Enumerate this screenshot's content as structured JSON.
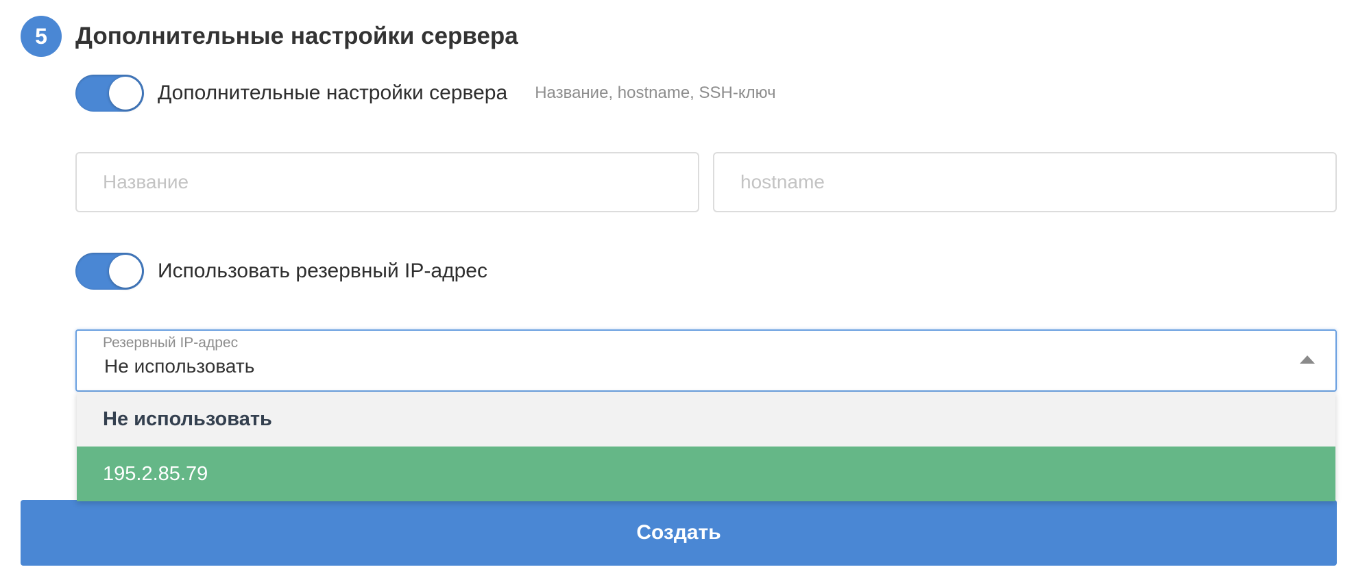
{
  "section": {
    "step_number": "5",
    "title": "Дополнительные настройки сервера"
  },
  "extra_settings_toggle": {
    "label": "Дополнительные настройки сервера",
    "hint": "Название, hostname, SSH-ключ",
    "enabled": true
  },
  "fields": {
    "name_placeholder": "Название",
    "name_value": "",
    "hostname_placeholder": "hostname",
    "hostname_value": ""
  },
  "reserve_ip_toggle": {
    "label": "Использовать резервный IP-адрес",
    "enabled": true
  },
  "reserve_ip_select": {
    "label": "Резервный IP-адрес",
    "selected": "Не использовать",
    "expanded": true,
    "options": [
      {
        "label": "Не использовать",
        "state": "selected"
      },
      {
        "label": "195.2.85.79",
        "state": "highlighted"
      }
    ]
  },
  "create_button": {
    "label": "Создать"
  },
  "colors": {
    "primary": "#4a87d4",
    "option_highlight": "#65b787",
    "option_selected_bg": "#f2f2f2"
  }
}
